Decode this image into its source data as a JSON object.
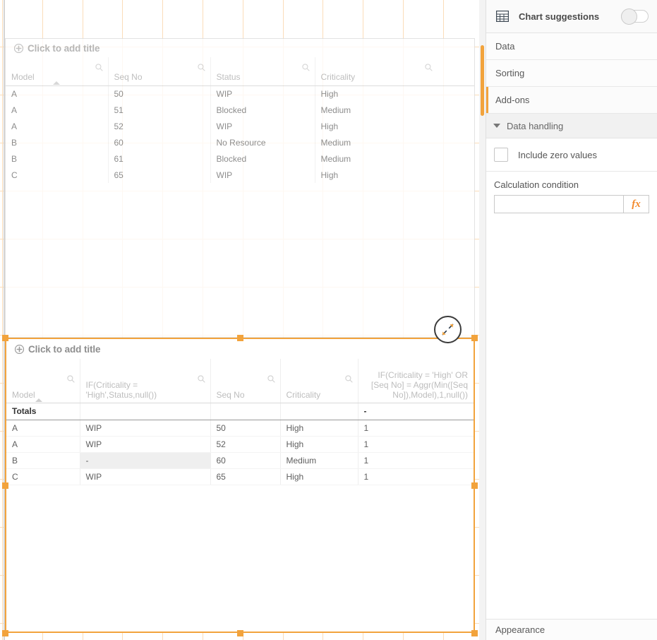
{
  "canvas": {
    "top_object": {
      "title_placeholder": "Click to add title",
      "add_icon": "plus-circle-icon",
      "sort_indicator": "sort-ascending-caret-icon",
      "search_icon": "search-icon",
      "columns": [
        {
          "label": "Model",
          "align": "left",
          "has_search": true,
          "sorted": true
        },
        {
          "label": "Seq No",
          "align": "right",
          "has_search": true,
          "sorted": false
        },
        {
          "label": "Status",
          "align": "left",
          "has_search": true,
          "sorted": false
        },
        {
          "label": "Criticality",
          "align": "left",
          "has_search": true,
          "sorted": false
        }
      ],
      "rows": [
        [
          "A",
          "50",
          "WIP",
          "High"
        ],
        [
          "A",
          "51",
          "Blocked",
          "Medium"
        ],
        [
          "A",
          "52",
          "WIP",
          "High"
        ],
        [
          "B",
          "60",
          "No Resource",
          "Medium"
        ],
        [
          "B",
          "61",
          "Blocked",
          "Medium"
        ],
        [
          "C",
          "65",
          "WIP",
          "High"
        ]
      ]
    },
    "expand_button": {
      "icon": "expand-diagonal-arrows-icon"
    },
    "bottom_object": {
      "title_placeholder": "Click to add title",
      "add_icon": "plus-circle-icon",
      "sort_indicator": "sort-ascending-caret-icon",
      "search_icon": "search-icon",
      "selected": true,
      "columns": [
        {
          "label": "Model",
          "align": "left",
          "has_search": true,
          "sorted": true
        },
        {
          "label": "IF(Criticality = 'High',Status,null())",
          "align": "left",
          "has_search": true,
          "sorted": false
        },
        {
          "label": "Seq No",
          "align": "right",
          "has_search": true,
          "sorted": false
        },
        {
          "label": "Criticality",
          "align": "left",
          "has_search": true,
          "sorted": false
        },
        {
          "label": "IF(Criticality = 'High' OR [Seq No] = Aggr(Min([Seq No]),Model),1,null())",
          "align": "right",
          "has_search": false,
          "sorted": false
        }
      ],
      "totals_row": {
        "label": "Totals",
        "values": [
          "",
          "",
          "",
          "-"
        ]
      },
      "rows": [
        {
          "cells": [
            "A",
            "WIP",
            "50",
            "High",
            "1"
          ],
          "null_cell_index": -1
        },
        {
          "cells": [
            "A",
            "WIP",
            "52",
            "High",
            "1"
          ],
          "null_cell_index": -1
        },
        {
          "cells": [
            "B",
            "-",
            "60",
            "Medium",
            "1"
          ],
          "null_cell_index": 1
        },
        {
          "cells": [
            "C",
            "WIP",
            "65",
            "High",
            "1"
          ],
          "null_cell_index": -1
        }
      ]
    }
  },
  "panel": {
    "header": {
      "icon": "table-chart-icon",
      "title": "Chart suggestions",
      "toggle_state": "off"
    },
    "accordion": [
      {
        "label": "Data",
        "active": false
      },
      {
        "label": "Sorting",
        "active": false
      },
      {
        "label": "Add-ons",
        "active": true
      }
    ],
    "section": {
      "caret_icon": "caret-down-icon",
      "title": "Data handling"
    },
    "include_zero": {
      "label": "Include zero values",
      "checked": false,
      "icon": "checkbox-icon"
    },
    "calculation_condition": {
      "label": "Calculation condition",
      "value": "",
      "placeholder": "",
      "expression_button": "fx",
      "expression_icon": "fx-icon"
    },
    "footer": {
      "label": "Appearance"
    }
  },
  "colors": {
    "accent_orange": "#f2a33c",
    "grid_line": "#fbddb9",
    "panel_border": "#e0e0e0",
    "text_muted": "#b0b0b0",
    "text_body": "#5f5f5f"
  }
}
